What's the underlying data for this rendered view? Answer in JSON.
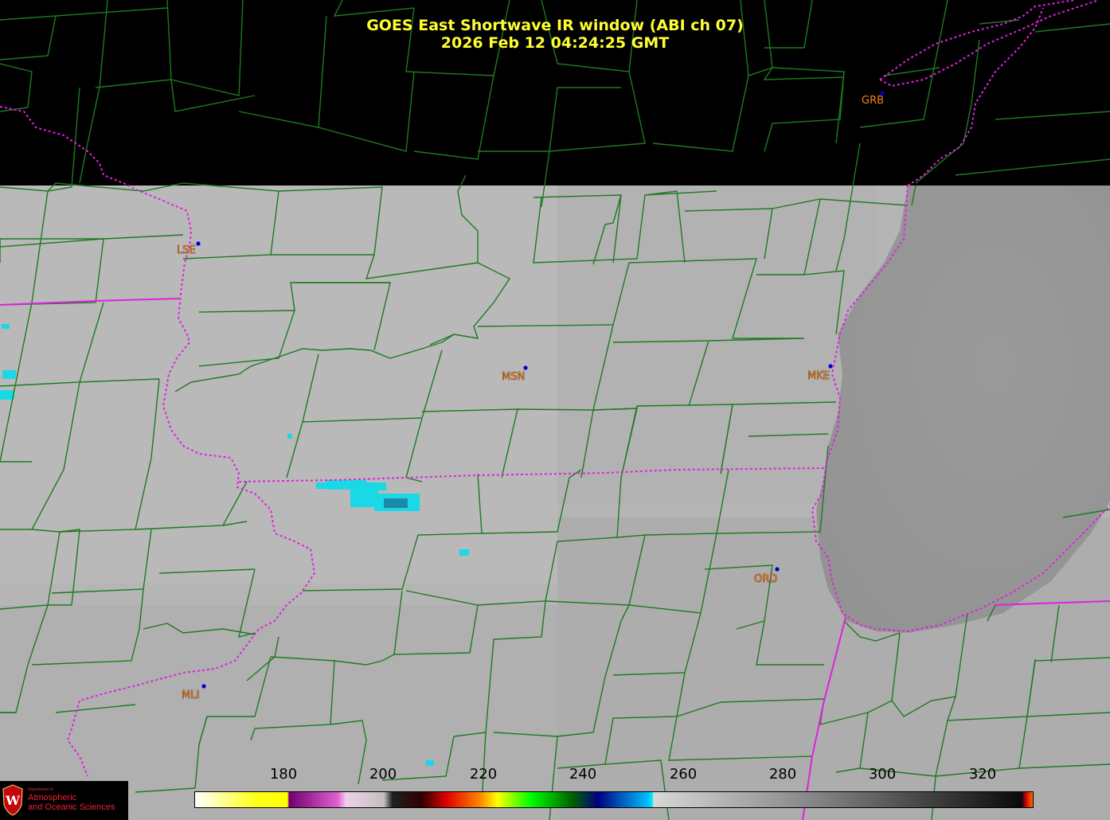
{
  "title": {
    "line1": "GOES East Shortwave IR window (ABI ch 07)",
    "line2": "2026 Feb 12  04:24:25 GMT"
  },
  "stations": [
    {
      "code": "GRB"
    },
    {
      "code": "LSE"
    },
    {
      "code": "MSN"
    },
    {
      "code": "MKE"
    },
    {
      "code": "ORD"
    },
    {
      "code": "MLI"
    }
  ],
  "colorbar": {
    "ticks": [
      "180",
      "200",
      "220",
      "240",
      "260",
      "280",
      "300",
      "320"
    ]
  },
  "logo": {
    "dept": "Department of",
    "line1": "Atmospheric",
    "line2": "and Oceanic Sciences"
  },
  "colors": {
    "title": "#ffff33",
    "county_lines": "#1f7a1f",
    "state_lines": "#e020e0",
    "station_label": "#f58220",
    "station_marker": "#0000cc",
    "cold_cloud": "#19d9e6"
  }
}
